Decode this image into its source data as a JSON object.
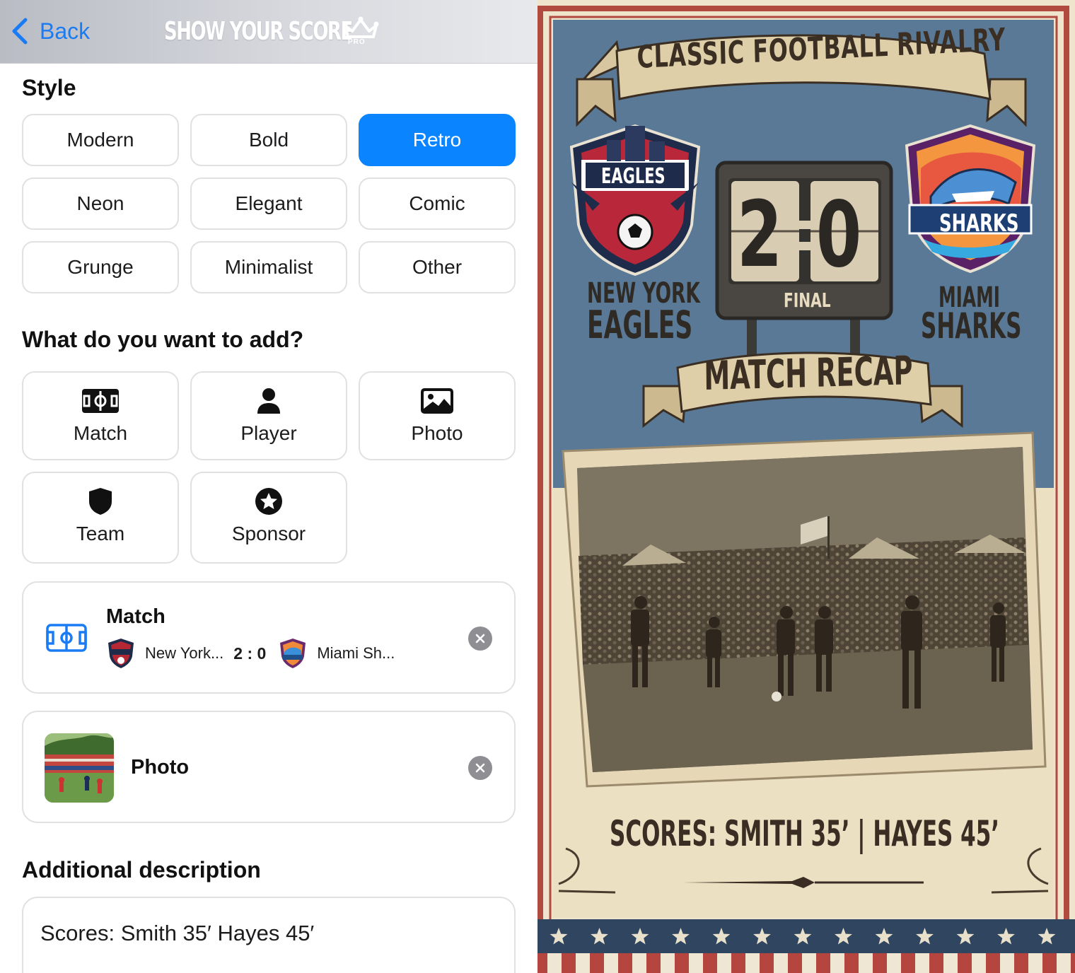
{
  "header": {
    "back_label": "Back",
    "brand_title": "SHOW YOUR SCORE",
    "brand_badge": "PRO"
  },
  "style_section": {
    "title": "Style",
    "options": [
      "Modern",
      "Bold",
      "Retro",
      "Neon",
      "Elegant",
      "Comic",
      "Grunge",
      "Minimalist",
      "Other"
    ],
    "selected": "Retro"
  },
  "add_section": {
    "title": "What do you want to add?",
    "items": [
      {
        "label": "Match",
        "icon": "pitch-icon"
      },
      {
        "label": "Player",
        "icon": "person-icon"
      },
      {
        "label": "Photo",
        "icon": "photo-icon"
      },
      {
        "label": "Team",
        "icon": "shield-icon"
      },
      {
        "label": "Sponsor",
        "icon": "star-badge-icon"
      }
    ]
  },
  "added": {
    "match": {
      "title": "Match",
      "home": "New York...",
      "score": "2 : 0",
      "away": "Miami Sh..."
    },
    "photo": {
      "title": "Photo"
    }
  },
  "description": {
    "title": "Additional description",
    "value": "Scores: Smith 35′ Hayes 45′"
  },
  "poster": {
    "headline": "CLASSIC FOOTBALL RIVALRY",
    "home_team_line1": "NEW YORK",
    "home_team_line2": "EAGLES",
    "away_team_line1": "MIAMI",
    "away_team_line2": "SHARKS",
    "home_score": "2",
    "away_score": "0",
    "status": "FINAL",
    "subtitle": "MATCH RECAP",
    "scorers": "SCORES: SMITH 35’ | HAYES 45’",
    "home_crest_text": "EAGLES",
    "away_crest_text": "SHARKS"
  },
  "colors": {
    "accent": "#0a84ff",
    "poster_blue": "#5c7c99",
    "poster_paper": "#efe5cf",
    "poster_red": "#b5463f",
    "poster_navy": "#2c3e55"
  }
}
